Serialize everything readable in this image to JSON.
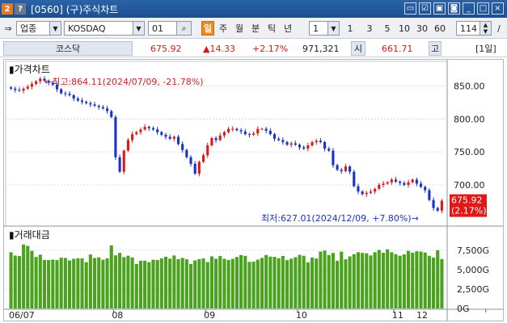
{
  "window": {
    "screen_no": "2",
    "help": "?",
    "title": "[0560] (구)주식차트"
  },
  "toolbar": {
    "market_select": "업종",
    "index_select": "KOSDAQ",
    "interval_value": "01",
    "periods": [
      "일",
      "주",
      "월",
      "분",
      "틱",
      "년"
    ],
    "active_period": "일",
    "unit_select": "1",
    "presets": [
      "1",
      "3",
      "5",
      "10",
      "30",
      "60"
    ],
    "count_value": "114",
    "count_suffix": "/"
  },
  "quote": {
    "name": "코스닥",
    "price": "675.92",
    "change": "▲14.33",
    "change_pct": "+2.17%",
    "volume": "971,321",
    "open_label": "시",
    "open": "661.71",
    "high_label": "고",
    "period_tag": "[1일]"
  },
  "chart_data": [
    {
      "type": "candlestick",
      "title": "가격차트",
      "x_tick_labels": [
        "06/07",
        "08",
        "09",
        "10",
        "11",
        "12"
      ],
      "y_tick_labels": [
        "850.00",
        "800.00",
        "750.00",
        "700.00"
      ],
      "ylim": [
        640,
        880
      ],
      "close_series": [
        846,
        844,
        843,
        846,
        849,
        853,
        857,
        861,
        858,
        855,
        852,
        845,
        839,
        838,
        836,
        831,
        828,
        826,
        824,
        822,
        820,
        818,
        816,
        812,
        803,
        742,
        720,
        752,
        768,
        777,
        780,
        784,
        788,
        786,
        784,
        780,
        776,
        773,
        770,
        773,
        762,
        753,
        742,
        732,
        717,
        735,
        745,
        760,
        771,
        768,
        775,
        780,
        785,
        785,
        783,
        781,
        777,
        776,
        778,
        785,
        785,
        782,
        777,
        770,
        768,
        765,
        761,
        763,
        761,
        757,
        755,
        760,
        765,
        767,
        765,
        755,
        752,
        730,
        723,
        721,
        728,
        720,
        698,
        690,
        686,
        688,
        690,
        694,
        700,
        702,
        704,
        708,
        705,
        703,
        700,
        704,
        708,
        702,
        697,
        692,
        677,
        665,
        661,
        676
      ],
      "last_price": "675.92",
      "last_pct": "(2.17%)",
      "high_note": "←최고:864.11(2024/07/09, -21.78%)",
      "low_note": "최저:627.01(2024/12/09, +7.80%)→",
      "colors": {
        "up": "#e01818",
        "down": "#1a32c8"
      }
    },
    {
      "type": "bar",
      "title": "거래대금",
      "y_tick_labels": [
        "7,500G",
        "5,000G",
        "2,500G",
        "0G"
      ],
      "ylim": [
        0,
        10000
      ],
      "values": [
        7260,
        6820,
        6760,
        8250,
        8070,
        7430,
        6640,
        6940,
        6260,
        6250,
        6300,
        6250,
        6550,
        6510,
        6200,
        6410,
        6480,
        6460,
        5970,
        6960,
        6510,
        6590,
        6290,
        6470,
        8140,
        6850,
        7170,
        6630,
        6800,
        6580,
        5740,
        6160,
        6160,
        5970,
        6290,
        6250,
        6450,
        6670,
        6430,
        6840,
        6360,
        6520,
        6340,
        5740,
        6200,
        6360,
        6460,
        5990,
        6720,
        6420,
        6760,
        6410,
        6260,
        6400,
        6640,
        6900,
        6790,
        6010,
        6040,
        6300,
        6520,
        6900,
        6690,
        6660,
        6480,
        6770,
        6240,
        6420,
        6620,
        6920,
        6790,
        5950,
        6570,
        6440,
        7340,
        7470,
        6890,
        7160,
        6160,
        7330,
        6340,
        6720,
        7000,
        7260,
        7170,
        7120,
        6840,
        7260,
        7540,
        7180,
        7630,
        7250,
        7000,
        6810,
        6980,
        7430,
        7190,
        7380,
        7340,
        7220,
        6790,
        6560,
        7510,
        6380
      ],
      "color": "#4aa21e"
    }
  ]
}
